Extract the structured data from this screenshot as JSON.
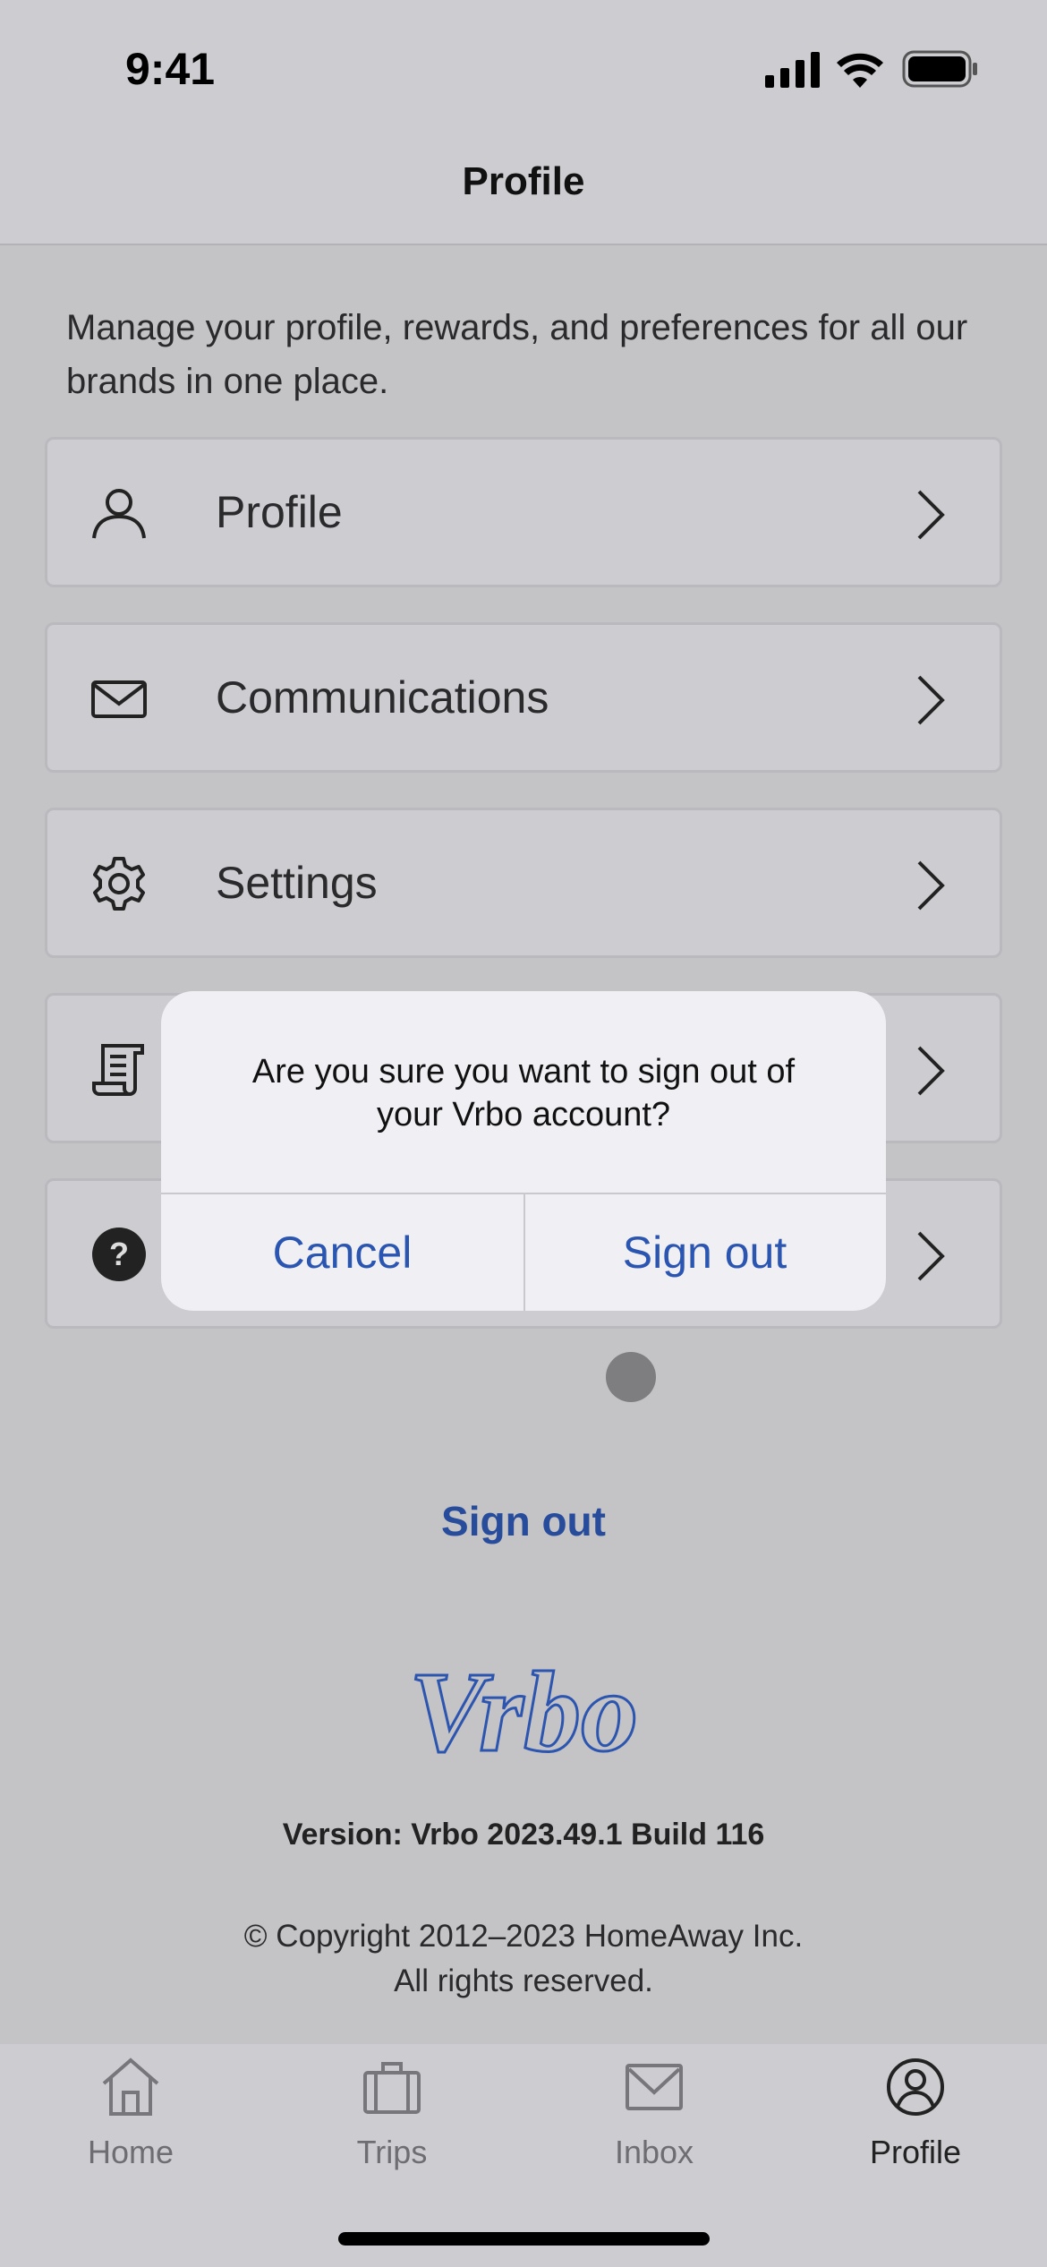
{
  "status_bar": {
    "time": "9:41"
  },
  "header": {
    "title": "Profile"
  },
  "description": "Manage your profile, rewards, and preferences for all our brands in one place.",
  "menu": [
    {
      "label": "Profile",
      "icon": "person-icon"
    },
    {
      "label": "Communications",
      "icon": "envelope-icon"
    },
    {
      "label": "Settings",
      "icon": "gear-icon"
    },
    {
      "label": "",
      "icon": "scroll-icon"
    },
    {
      "label": "",
      "icon": "help-icon"
    }
  ],
  "dialog": {
    "message": "Are you sure you want to sign out of your Vrbo account?",
    "cancel": "Cancel",
    "confirm": "Sign out"
  },
  "sign_out_link": "Sign out",
  "logo": "Vrbo",
  "version": "Version: Vrbo 2023.49.1 Build 116",
  "copyright": [
    "© Copyright 2012–2023 HomeAway Inc.",
    "All rights reserved."
  ],
  "tabs": [
    {
      "label": "Home",
      "icon": "home-icon"
    },
    {
      "label": "Trips",
      "icon": "suitcase-icon"
    },
    {
      "label": "Inbox",
      "icon": "inbox-icon"
    },
    {
      "label": "Profile",
      "icon": "profile-icon",
      "active": true
    }
  ],
  "colors": {
    "accent": "#2a55b0",
    "link": "#284c9c",
    "dialog_bg": "#f0eff4"
  }
}
